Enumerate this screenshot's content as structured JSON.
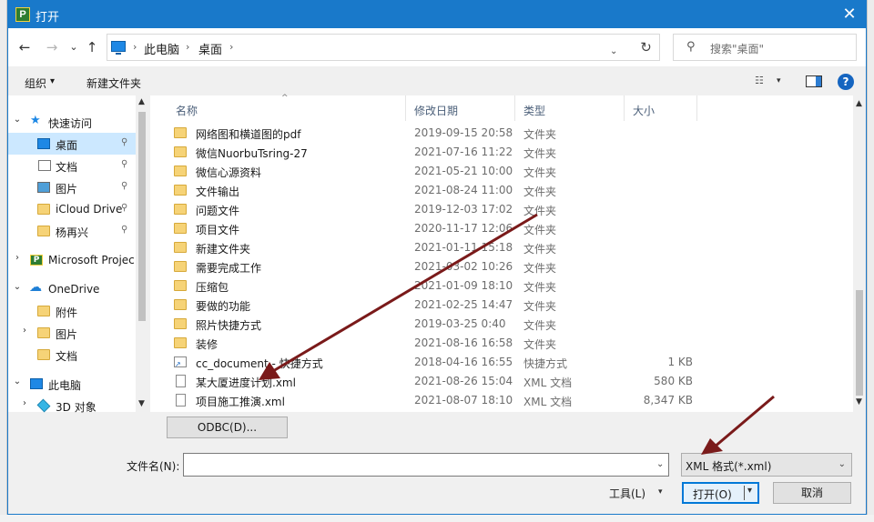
{
  "window": {
    "title": "打开",
    "app_icon_letter": "P",
    "close_glyph": "✕"
  },
  "nav": {
    "back": "←",
    "forward": "→",
    "recent": "⌄",
    "up": "↑"
  },
  "address": {
    "crumbs": [
      "此电脑",
      "桌面"
    ],
    "sep": "›",
    "dropdown": "⌄",
    "refresh": "↻"
  },
  "search": {
    "placeholder": "搜索\"桌面\"",
    "icon": "⚲"
  },
  "toolbar": {
    "organize": "组织",
    "organize_dd": "▾",
    "new_folder": "新建文件夹",
    "view_glyph": "☷",
    "view_dd": "▾",
    "help": "?"
  },
  "sidebar": {
    "items": [
      {
        "label": "快速访问",
        "chevron": "⌄",
        "icon": "star-icon",
        "pinned": false
      },
      {
        "label": "桌面",
        "icon": "desktop-icon",
        "pinned": true,
        "selected": true
      },
      {
        "label": "文档",
        "icon": "document-icon",
        "pinned": true
      },
      {
        "label": "图片",
        "icon": "picture-icon",
        "pinned": true
      },
      {
        "label": "iCloud Drive",
        "icon": "folder-icon",
        "pinned": true
      },
      {
        "label": "杨再兴",
        "icon": "folder-icon",
        "pinned": true
      },
      {
        "label": "Microsoft Projec",
        "chevron": "›",
        "icon": "project-icon"
      },
      {
        "label": "OneDrive",
        "chevron": "⌄",
        "icon": "cloud-icon"
      },
      {
        "label": "附件",
        "icon": "folder-icon"
      },
      {
        "label": "图片",
        "chevron": "›",
        "icon": "folder-icon"
      },
      {
        "label": "文档",
        "icon": "folder-icon"
      },
      {
        "label": "此电脑",
        "chevron": "⌄",
        "icon": "pc-icon"
      },
      {
        "label": "3D 对象",
        "chevron": "›",
        "icon": "3d-objects-icon"
      }
    ],
    "pin_glyph": "📌"
  },
  "filelist": {
    "columns": {
      "name": "名称",
      "date": "修改日期",
      "type": "类型",
      "size": "大小"
    },
    "sort_glyph": "^",
    "rows": [
      {
        "name": "网络图和横道图的pdf",
        "date": "2019-09-15 20:58",
        "type": "文件夹",
        "size": "",
        "icon": "folder-icon"
      },
      {
        "name": "微信NuorbuTsring-27",
        "date": "2021-07-16 11:22",
        "type": "文件夹",
        "size": "",
        "icon": "folder-icon"
      },
      {
        "name": "微信心源资料",
        "date": "2021-05-21 10:00",
        "type": "文件夹",
        "size": "",
        "icon": "folder-icon"
      },
      {
        "name": "文件输出",
        "date": "2021-08-24 11:00",
        "type": "文件夹",
        "size": "",
        "icon": "folder-icon"
      },
      {
        "name": "问题文件",
        "date": "2019-12-03 17:02",
        "type": "文件夹",
        "size": "",
        "icon": "folder-icon"
      },
      {
        "name": "项目文件",
        "date": "2020-11-17 12:06",
        "type": "文件夹",
        "size": "",
        "icon": "folder-icon"
      },
      {
        "name": "新建文件夹",
        "date": "2021-01-11 15:18",
        "type": "文件夹",
        "size": "",
        "icon": "folder-icon"
      },
      {
        "name": "需要完成工作",
        "date": "2021-03-02 10:26",
        "type": "文件夹",
        "size": "",
        "icon": "folder-icon"
      },
      {
        "name": "压缩包",
        "date": "2021-01-09 18:10",
        "type": "文件夹",
        "size": "",
        "icon": "folder-icon"
      },
      {
        "name": "要做的功能",
        "date": "2021-02-25 14:47",
        "type": "文件夹",
        "size": "",
        "icon": "folder-icon"
      },
      {
        "name": "照片快捷方式",
        "date": "2019-03-25 0:40",
        "type": "文件夹",
        "size": "",
        "icon": "folder-icon"
      },
      {
        "name": "装修",
        "date": "2021-08-16 16:58",
        "type": "文件夹",
        "size": "",
        "icon": "folder-icon"
      },
      {
        "name": "cc_document - 快捷方式",
        "date": "2018-04-16 16:55",
        "type": "快捷方式",
        "size": "1 KB",
        "icon": "shortcut-icon"
      },
      {
        "name": "某大厦进度计划.xml",
        "date": "2021-08-26 15:04",
        "type": "XML 文档",
        "size": "580 KB",
        "icon": "xml-file-icon"
      },
      {
        "name": "项目施工推演.xml",
        "date": "2021-08-07 18:10",
        "type": "XML 文档",
        "size": "8,347 KB",
        "icon": "xml-file-icon"
      }
    ]
  },
  "scroll": {
    "up": "▲",
    "down": "▼"
  },
  "bottom": {
    "odbc_label": "ODBC(D)...",
    "filename_label": "文件名(N):",
    "filename_value": "",
    "filename_dd": "⌄",
    "filetype_value": "XML 格式(*.xml)",
    "filetype_dd": "⌄",
    "tools_label": "工具(L)",
    "tools_dd": "▾",
    "open_label": "打开(O)",
    "open_dd": "▾",
    "cancel_label": "取消"
  },
  "colors": {
    "titlebar": "#1979ca",
    "selection": "#cce8ff",
    "annotation_arrow": "#7a1a1a"
  }
}
